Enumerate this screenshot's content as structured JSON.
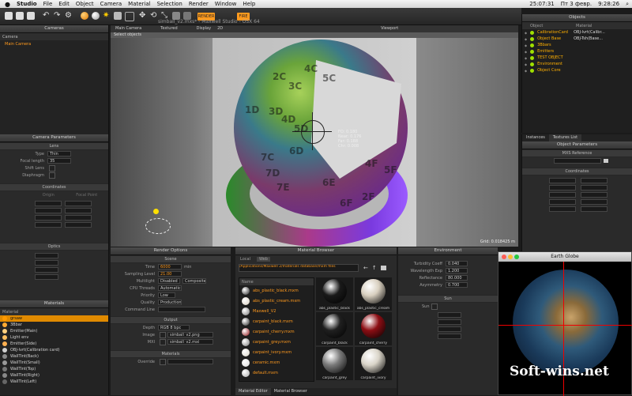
{
  "menubar": {
    "apple": "",
    "items": [
      "Studio",
      "File",
      "Edit",
      "Object",
      "Camera",
      "Material",
      "Selection",
      "Render",
      "Window",
      "Help"
    ],
    "clock": "25:07:31",
    "user_date": "Пт 3 февр.",
    "time": "9:28:26"
  },
  "toolbar": {
    "title": "simball_v2.mxs* - Maxwell Studio - OSX 64",
    "btn1": "RENDER",
    "btn2": "FIRE"
  },
  "cameras": {
    "title": "Cameras",
    "header": "Camera",
    "items": [
      "Main Camera"
    ]
  },
  "camera_params": {
    "title": "Camera Parameters",
    "lens_section": "Lens",
    "lens_rows": [
      {
        "label": "Type",
        "value": "Thin"
      },
      {
        "label": "Focal length",
        "value": "35"
      },
      {
        "label": "Shift Lens",
        "value": ""
      },
      {
        "label": "Diaphragm",
        "value": ""
      }
    ],
    "coords_section": "Coordinates",
    "coords_cols": [
      "Origin",
      "Focal Point"
    ],
    "optics_section": "Optics"
  },
  "materials_panel": {
    "title": "Materials",
    "header": "Material",
    "items": [
      {
        "label": "grsaw",
        "color": "#ff9900",
        "selected": true
      },
      {
        "label": "3Bbar",
        "color": "#ffaa33"
      },
      {
        "label": "Emitter(Main)",
        "color": "#ffd080"
      },
      {
        "label": "Light env",
        "color": "#ffc060"
      },
      {
        "label": "Emitter(Side)",
        "color": "#ffb050"
      },
      {
        "label": "OBJ-Ivrt(Calibration card)",
        "color": "#d0d0d0"
      },
      {
        "label": "WallTint(Back)",
        "color": "#888888"
      },
      {
        "label": "WallTint(Small)",
        "color": "#999999"
      },
      {
        "label": "WallTint(Top)",
        "color": "#777777"
      },
      {
        "label": "WallTint(Right)",
        "color": "#888888"
      },
      {
        "label": "WallTint(Left)",
        "color": "#666666"
      }
    ]
  },
  "viewport": {
    "tabs": [
      "Main Camera",
      "Textured",
      "Display",
      "2D",
      "Viewport"
    ],
    "select_label": "Select objects",
    "hud": [
      "FO: 0.180",
      "Near: 0.176",
      "Far: 0.188",
      "Chr: 0.008"
    ],
    "grid_label": "Grid: 0.018425 m",
    "sphere_labels": [
      "2C",
      "3C",
      "4C",
      "5C",
      "1D",
      "3D",
      "4D",
      "5D",
      "6D",
      "7C",
      "7D",
      "7E",
      "6E",
      "6F",
      "2F",
      "4F",
      "5F"
    ]
  },
  "render_options": {
    "title": "Render Options",
    "scene_section": "Scene",
    "rows": [
      {
        "label": "Time",
        "value": "6000",
        "unit": "min"
      },
      {
        "label": "Sampling Level",
        "value": "21.00"
      },
      {
        "label": "Multilight",
        "value": "Disabled",
        "extra": "Composite"
      },
      {
        "label": "CPU Threads",
        "value": "Automatic"
      },
      {
        "label": "Priority",
        "value": "Low"
      },
      {
        "label": "Quality",
        "value": "Production"
      },
      {
        "label": "Command Line",
        "value": ""
      }
    ],
    "output_section": "Output",
    "output_rows": [
      {
        "label": "Depth",
        "value": "RGB  8 bpc"
      },
      {
        "label": "Image",
        "value": "simball_v2.png"
      },
      {
        "label": "MXI",
        "value": "simball_v2.mxi"
      }
    ],
    "materials_section": "Materials",
    "override_label": "Override"
  },
  "material_browser": {
    "title": "Material Browser",
    "tabs": [
      "Local",
      "Web"
    ],
    "path": "/Applications/Maxwell 2/materials database/mxm files",
    "list_header": "Name",
    "list": [
      "abs_plastic_black.mxm",
      "abs_plastic_cream.mxm",
      "Maxwell_V2",
      "carpaint_black.mxm",
      "carpaint_cherry.mxm",
      "carpaint_grey.mxm",
      "carpaint_ivory.mxm",
      "ceramic.mxm",
      "default.mxm"
    ],
    "thumbs": [
      {
        "label": "abs_plastic_black",
        "color": "#1a1a1a"
      },
      {
        "label": "abs_plastic_cream",
        "color": "#d8cfbf"
      },
      {
        "label": "carpaint_black",
        "color": "#202020"
      },
      {
        "label": "carpaint_cherry",
        "color": "#8c0e14"
      },
      {
        "label": "carpaint_grey",
        "color": "#7a7a7a"
      },
      {
        "label": "carpaint_ivory",
        "color": "#d9d4c8"
      }
    ],
    "bottom_tabs": [
      "Material Editor",
      "Material Browser"
    ]
  },
  "environment": {
    "title": "Environment",
    "rows": [
      {
        "label": "Turbidity Coeff",
        "value": "0.040"
      },
      {
        "label": "Wavelength Exp",
        "value": "1.200"
      },
      {
        "label": "Reflectance",
        "value": "80.000"
      },
      {
        "label": "Asymmetry",
        "value": "0.700"
      }
    ],
    "sun_section": "Sun",
    "sun_label": "Sun"
  },
  "objects_panel": {
    "title": "Objects",
    "col_object": "Object",
    "col_material": "Material",
    "items": [
      {
        "label": "CalibrationCard",
        "material": "OBJ-Ivrt(Calibr..."
      },
      {
        "label": "Object Base",
        "material": "OBJ-Tsh(Base..."
      },
      {
        "label": "3Bbars",
        "material": ""
      },
      {
        "label": "Emitters",
        "material": ""
      },
      {
        "label": "TEST OBJECT",
        "material": ""
      },
      {
        "label": "Environment",
        "material": ""
      },
      {
        "label": "Object Core",
        "material": ""
      }
    ]
  },
  "side_tabs": [
    "Instances",
    "Textures List"
  ],
  "object_params": {
    "title": "Object Parameters",
    "ref_label": "MXS Reference",
    "section": "Coordinates"
  },
  "earth_globe": {
    "title": "Earth Globe"
  },
  "watermark": "Soft-wins.net",
  "colors": {
    "accent": "#ff9900",
    "selected_row": "#e08a00",
    "panel_bg": "#2b2b2b"
  }
}
